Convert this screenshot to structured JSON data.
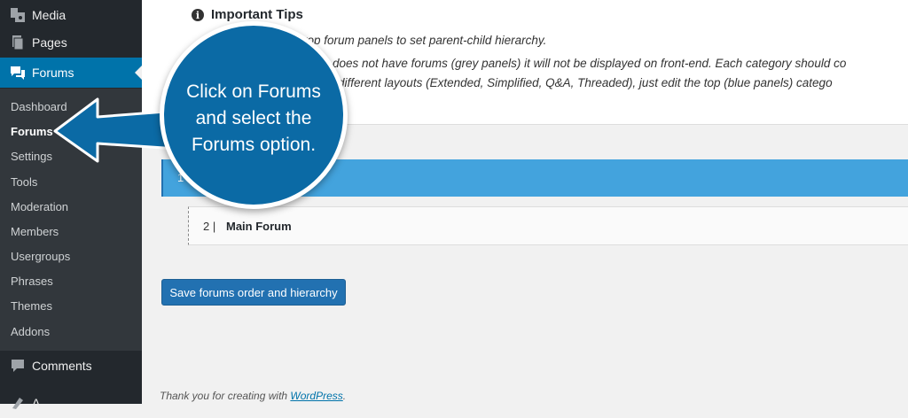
{
  "sidebar": {
    "items": [
      {
        "label": "Media",
        "icon": "media-icon"
      },
      {
        "label": "Pages",
        "icon": "pages-icon"
      },
      {
        "label": "Forums",
        "icon": "forums-icon"
      },
      {
        "label": "Comments",
        "icon": "comments-icon"
      },
      {
        "label": "A",
        "icon": "appearance-icon"
      }
    ],
    "submenu": [
      "Dashboard",
      "Forums",
      "Settings",
      "Tools",
      "Moderation",
      "Members",
      "Usergroups",
      "Phrases",
      "Themes",
      "Addons"
    ]
  },
  "tips": {
    "title": "Important Tips",
    "lines": [
      "rop forum panels to set parent-child hierarchy.",
      "nels) does not have forums (grey panels) it will not be displayed on front-end. Each category should co",
      "d with different layouts (Extended, Simplified, Q&A, Threaded), just edit the top (blue panels) catego"
    ]
  },
  "panels": {
    "blue_number": "1",
    "grey_number": "2  |",
    "grey_title": "Main Forum"
  },
  "save_button": "Save forums order and hierarchy",
  "footer": {
    "text": "Thank you for creating with ",
    "link": "WordPress",
    "end": "."
  },
  "callout": {
    "line1": "Click on Forums",
    "line2": "and select the",
    "line3": "Forums option."
  },
  "colors": {
    "accent": "#0073aa",
    "callout": "#0b6aa5",
    "blue_panel": "#43a3dd",
    "sidebar": "#23282d"
  }
}
